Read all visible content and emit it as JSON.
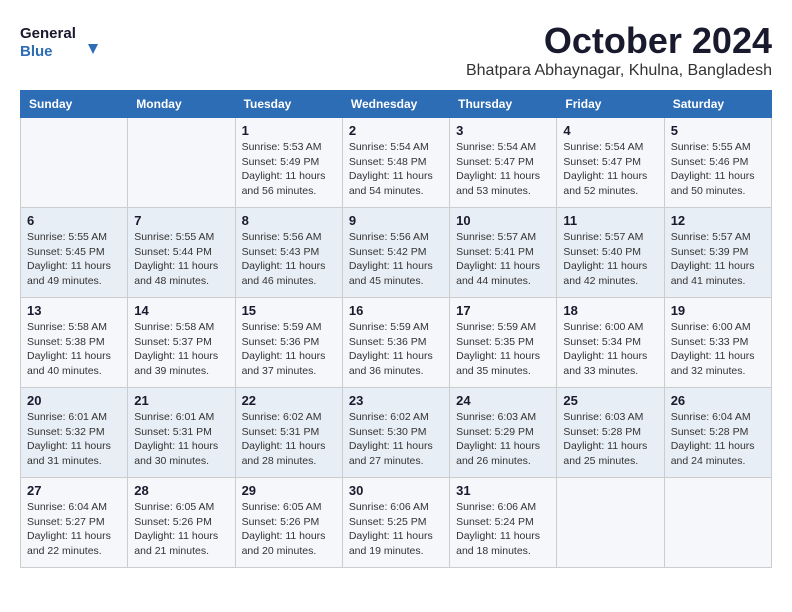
{
  "logo": {
    "line1": "General",
    "line2": "Blue"
  },
  "title": "October 2024",
  "location": "Bhatpara Abhaynagar, Khulna, Bangladesh",
  "headers": [
    "Sunday",
    "Monday",
    "Tuesday",
    "Wednesday",
    "Thursday",
    "Friday",
    "Saturday"
  ],
  "weeks": [
    [
      {
        "day": "",
        "sunrise": "",
        "sunset": "",
        "daylight": ""
      },
      {
        "day": "",
        "sunrise": "",
        "sunset": "",
        "daylight": ""
      },
      {
        "day": "1",
        "sunrise": "Sunrise: 5:53 AM",
        "sunset": "Sunset: 5:49 PM",
        "daylight": "Daylight: 11 hours and 56 minutes."
      },
      {
        "day": "2",
        "sunrise": "Sunrise: 5:54 AM",
        "sunset": "Sunset: 5:48 PM",
        "daylight": "Daylight: 11 hours and 54 minutes."
      },
      {
        "day": "3",
        "sunrise": "Sunrise: 5:54 AM",
        "sunset": "Sunset: 5:47 PM",
        "daylight": "Daylight: 11 hours and 53 minutes."
      },
      {
        "day": "4",
        "sunrise": "Sunrise: 5:54 AM",
        "sunset": "Sunset: 5:47 PM",
        "daylight": "Daylight: 11 hours and 52 minutes."
      },
      {
        "day": "5",
        "sunrise": "Sunrise: 5:55 AM",
        "sunset": "Sunset: 5:46 PM",
        "daylight": "Daylight: 11 hours and 50 minutes."
      }
    ],
    [
      {
        "day": "6",
        "sunrise": "Sunrise: 5:55 AM",
        "sunset": "Sunset: 5:45 PM",
        "daylight": "Daylight: 11 hours and 49 minutes."
      },
      {
        "day": "7",
        "sunrise": "Sunrise: 5:55 AM",
        "sunset": "Sunset: 5:44 PM",
        "daylight": "Daylight: 11 hours and 48 minutes."
      },
      {
        "day": "8",
        "sunrise": "Sunrise: 5:56 AM",
        "sunset": "Sunset: 5:43 PM",
        "daylight": "Daylight: 11 hours and 46 minutes."
      },
      {
        "day": "9",
        "sunrise": "Sunrise: 5:56 AM",
        "sunset": "Sunset: 5:42 PM",
        "daylight": "Daylight: 11 hours and 45 minutes."
      },
      {
        "day": "10",
        "sunrise": "Sunrise: 5:57 AM",
        "sunset": "Sunset: 5:41 PM",
        "daylight": "Daylight: 11 hours and 44 minutes."
      },
      {
        "day": "11",
        "sunrise": "Sunrise: 5:57 AM",
        "sunset": "Sunset: 5:40 PM",
        "daylight": "Daylight: 11 hours and 42 minutes."
      },
      {
        "day": "12",
        "sunrise": "Sunrise: 5:57 AM",
        "sunset": "Sunset: 5:39 PM",
        "daylight": "Daylight: 11 hours and 41 minutes."
      }
    ],
    [
      {
        "day": "13",
        "sunrise": "Sunrise: 5:58 AM",
        "sunset": "Sunset: 5:38 PM",
        "daylight": "Daylight: 11 hours and 40 minutes."
      },
      {
        "day": "14",
        "sunrise": "Sunrise: 5:58 AM",
        "sunset": "Sunset: 5:37 PM",
        "daylight": "Daylight: 11 hours and 39 minutes."
      },
      {
        "day": "15",
        "sunrise": "Sunrise: 5:59 AM",
        "sunset": "Sunset: 5:36 PM",
        "daylight": "Daylight: 11 hours and 37 minutes."
      },
      {
        "day": "16",
        "sunrise": "Sunrise: 5:59 AM",
        "sunset": "Sunset: 5:36 PM",
        "daylight": "Daylight: 11 hours and 36 minutes."
      },
      {
        "day": "17",
        "sunrise": "Sunrise: 5:59 AM",
        "sunset": "Sunset: 5:35 PM",
        "daylight": "Daylight: 11 hours and 35 minutes."
      },
      {
        "day": "18",
        "sunrise": "Sunrise: 6:00 AM",
        "sunset": "Sunset: 5:34 PM",
        "daylight": "Daylight: 11 hours and 33 minutes."
      },
      {
        "day": "19",
        "sunrise": "Sunrise: 6:00 AM",
        "sunset": "Sunset: 5:33 PM",
        "daylight": "Daylight: 11 hours and 32 minutes."
      }
    ],
    [
      {
        "day": "20",
        "sunrise": "Sunrise: 6:01 AM",
        "sunset": "Sunset: 5:32 PM",
        "daylight": "Daylight: 11 hours and 31 minutes."
      },
      {
        "day": "21",
        "sunrise": "Sunrise: 6:01 AM",
        "sunset": "Sunset: 5:31 PM",
        "daylight": "Daylight: 11 hours and 30 minutes."
      },
      {
        "day": "22",
        "sunrise": "Sunrise: 6:02 AM",
        "sunset": "Sunset: 5:31 PM",
        "daylight": "Daylight: 11 hours and 28 minutes."
      },
      {
        "day": "23",
        "sunrise": "Sunrise: 6:02 AM",
        "sunset": "Sunset: 5:30 PM",
        "daylight": "Daylight: 11 hours and 27 minutes."
      },
      {
        "day": "24",
        "sunrise": "Sunrise: 6:03 AM",
        "sunset": "Sunset: 5:29 PM",
        "daylight": "Daylight: 11 hours and 26 minutes."
      },
      {
        "day": "25",
        "sunrise": "Sunrise: 6:03 AM",
        "sunset": "Sunset: 5:28 PM",
        "daylight": "Daylight: 11 hours and 25 minutes."
      },
      {
        "day": "26",
        "sunrise": "Sunrise: 6:04 AM",
        "sunset": "Sunset: 5:28 PM",
        "daylight": "Daylight: 11 hours and 24 minutes."
      }
    ],
    [
      {
        "day": "27",
        "sunrise": "Sunrise: 6:04 AM",
        "sunset": "Sunset: 5:27 PM",
        "daylight": "Daylight: 11 hours and 22 minutes."
      },
      {
        "day": "28",
        "sunrise": "Sunrise: 6:05 AM",
        "sunset": "Sunset: 5:26 PM",
        "daylight": "Daylight: 11 hours and 21 minutes."
      },
      {
        "day": "29",
        "sunrise": "Sunrise: 6:05 AM",
        "sunset": "Sunset: 5:26 PM",
        "daylight": "Daylight: 11 hours and 20 minutes."
      },
      {
        "day": "30",
        "sunrise": "Sunrise: 6:06 AM",
        "sunset": "Sunset: 5:25 PM",
        "daylight": "Daylight: 11 hours and 19 minutes."
      },
      {
        "day": "31",
        "sunrise": "Sunrise: 6:06 AM",
        "sunset": "Sunset: 5:24 PM",
        "daylight": "Daylight: 11 hours and 18 minutes."
      },
      {
        "day": "",
        "sunrise": "",
        "sunset": "",
        "daylight": ""
      },
      {
        "day": "",
        "sunrise": "",
        "sunset": "",
        "daylight": ""
      }
    ]
  ]
}
